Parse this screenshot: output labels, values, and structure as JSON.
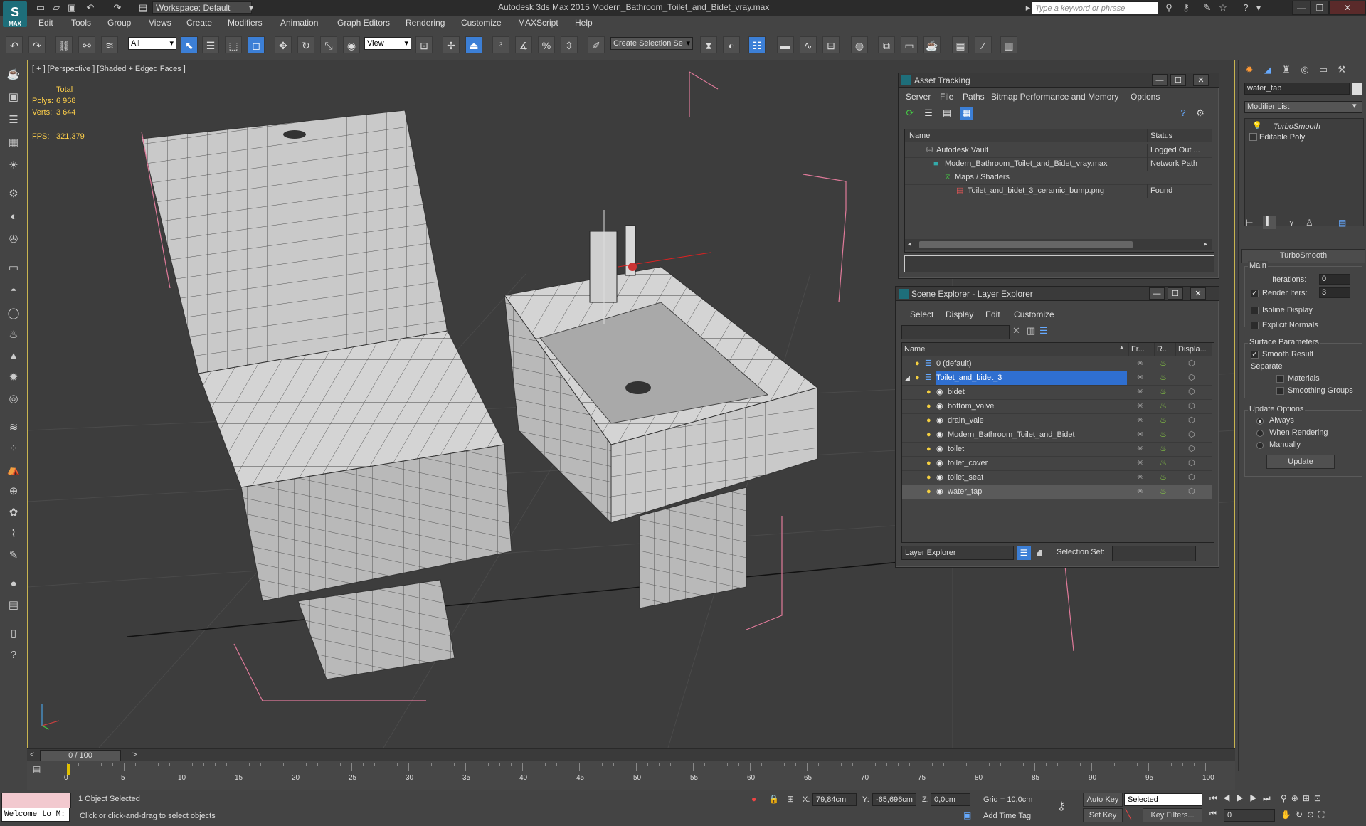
{
  "app": {
    "logo_text": "MAX",
    "workspace": "Workspace: Default",
    "window_title": "Autodesk 3ds Max  2015      Modern_Bathroom_Toilet_and_Bidet_vray.max",
    "search_placeholder": "Type a keyword or phrase"
  },
  "menus": [
    "Edit",
    "Tools",
    "Group",
    "Views",
    "Create",
    "Modifiers",
    "Animation",
    "Graph Editors",
    "Rendering",
    "Customize",
    "MAXScript",
    "Help"
  ],
  "toolbar": {
    "selection_filter": "All",
    "ref_coord": "View",
    "named_selection": "Create Selection Se"
  },
  "viewport": {
    "label": "[ + ] [Perspective ] [Shaded + Edged Faces ]",
    "stats_header": "Total",
    "polys_label": "Polys:",
    "polys_value": "6 968",
    "verts_label": "Verts:",
    "verts_value": "3 644",
    "fps_label": "FPS:",
    "fps_value": "321,379"
  },
  "asset_tracking": {
    "title": "Asset Tracking",
    "menus": [
      "Server",
      "File",
      "Paths",
      "Bitmap Performance and Memory",
      "Options"
    ],
    "col_name": "Name",
    "col_status": "Status",
    "rows": [
      {
        "name": "Autodesk Vault",
        "status": "Logged Out ..."
      },
      {
        "name": "Modern_Bathroom_Toilet_and_Bidet_vray.max",
        "status": "Network Path"
      },
      {
        "name": "Maps / Shaders",
        "status": ""
      },
      {
        "name": "Toilet_and_bidet_3_ceramic_bump.png",
        "status": "Found"
      }
    ]
  },
  "scene_explorer": {
    "title": "Scene Explorer - Layer Explorer",
    "menus": [
      "Select",
      "Display",
      "Edit",
      "Customize"
    ],
    "col_name": "Name",
    "col_freeze": "Fr...",
    "col_render": "R...",
    "col_display": "Displa...",
    "rows": [
      {
        "name": "0 (default)",
        "level": 0
      },
      {
        "name": "Toilet_and_bidet_3",
        "level": 0
      },
      {
        "name": "bidet",
        "level": 1
      },
      {
        "name": "bottom_valve",
        "level": 1
      },
      {
        "name": "drain_vale",
        "level": 1
      },
      {
        "name": "Modern_Bathroom_Toilet_and_Bidet",
        "level": 1
      },
      {
        "name": "toilet",
        "level": 1
      },
      {
        "name": "toilet_cover",
        "level": 1
      },
      {
        "name": "toilet_seat",
        "level": 1
      },
      {
        "name": "water_tap",
        "level": 1
      }
    ],
    "footer_mode": "Layer Explorer",
    "selection_set_label": "Selection Set:"
  },
  "command_panel": {
    "object_name": "water_tap",
    "modifier_list": "Modifier List",
    "stack": [
      "TurboSmooth",
      "Editable Poly"
    ],
    "rollout_title": "TurboSmooth",
    "main_label": "Main",
    "iterations_label": "Iterations:",
    "iterations_value": "0",
    "render_iters_label": "Render Iters:",
    "render_iters_value": "3",
    "isoline_label": "Isoline Display",
    "explicit_normals_label": "Explicit Normals",
    "surface_params_label": "Surface Parameters",
    "smooth_result_label": "Smooth Result",
    "separate_label": "Separate",
    "materials_label": "Materials",
    "smoothing_groups_label": "Smoothing Groups",
    "update_options_label": "Update Options",
    "always_label": "Always",
    "when_rendering_label": "When Rendering",
    "manually_label": "Manually",
    "update_button": "Update"
  },
  "timeline": {
    "frame_display": "0 / 100",
    "ticks": [
      "0",
      "5",
      "10",
      "15",
      "20",
      "25",
      "30",
      "35",
      "40",
      "45",
      "50",
      "55",
      "60",
      "65",
      "70",
      "75",
      "80",
      "85",
      "90",
      "95",
      "100"
    ]
  },
  "status": {
    "maxscript": "Welcome to M:",
    "selected_text": "1 Object Selected",
    "prompt_text": "Click or click-and-drag to select objects",
    "x_label": "X:",
    "x_value": "79,84cm",
    "y_label": "Y:",
    "y_value": "-65,696cm",
    "z_label": "Z:",
    "z_value": "0,0cm",
    "grid": "Grid = 10,0cm",
    "add_time_tag": "Add Time Tag",
    "auto_key": "Auto Key",
    "set_key": "Set Key",
    "selected_dropdown": "Selected",
    "key_filters": "Key Filters...",
    "frame_field": "0"
  }
}
